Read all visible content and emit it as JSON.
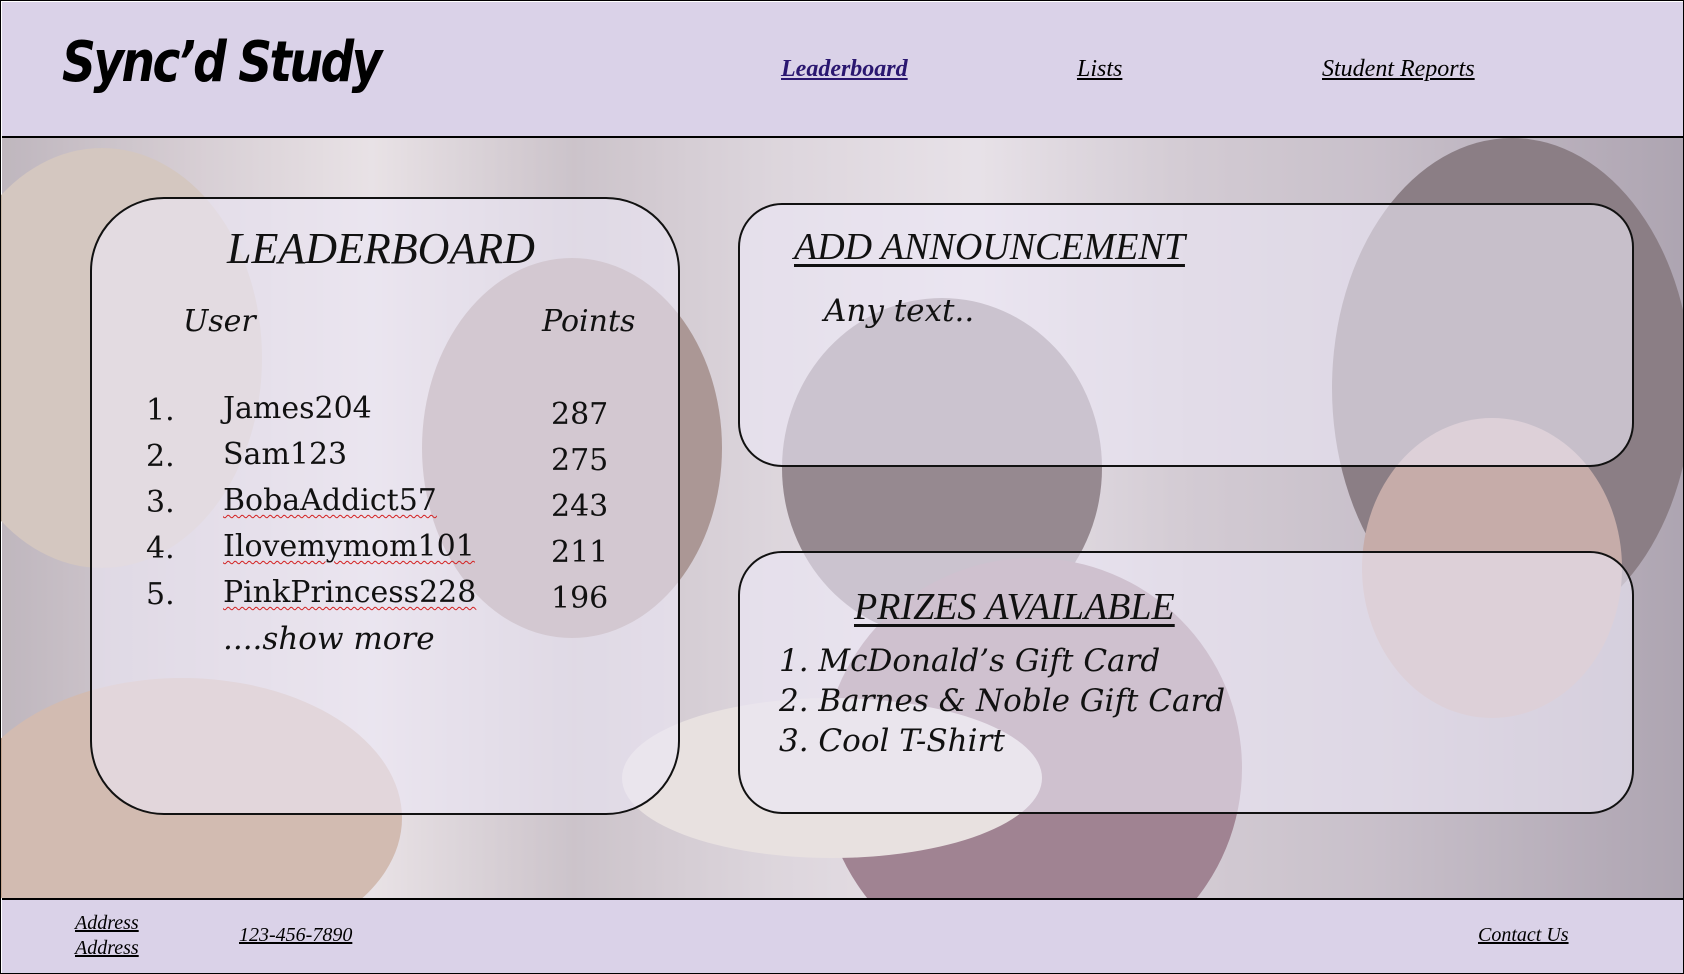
{
  "brand": {
    "logo": "Sync’d Study"
  },
  "nav": {
    "items": [
      {
        "label": "Leaderboard",
        "active": true
      },
      {
        "label": "Lists",
        "active": false
      },
      {
        "label": "Student Reports",
        "active": false
      }
    ]
  },
  "leaderboard": {
    "title": "LEADERBOARD",
    "col_user": "User",
    "col_points": "Points",
    "rows": [
      {
        "rank": "1.",
        "user": "James204",
        "points": "287"
      },
      {
        "rank": "2.",
        "user": "Sam123",
        "points": "275"
      },
      {
        "rank": "3.",
        "user": "BobaAddict57",
        "points": "243"
      },
      {
        "rank": "4.",
        "user": "Ilovemymom101",
        "points": "211"
      },
      {
        "rank": "5.",
        "user": "PinkPrincess228",
        "points": "196"
      }
    ],
    "show_more": "....show more"
  },
  "announcement": {
    "title": "ADD ANNOUNCEMENT",
    "text": "Any text.."
  },
  "prizes": {
    "title": "PRIZES AVAILABLE",
    "items": [
      "1. McDonald’s Gift Card",
      "2. Barnes & Noble Gift Card",
      "3. Cool T-Shirt"
    ]
  },
  "footer": {
    "address_line1": "Address",
    "address_line2": "Address",
    "phone": "123-456-7890",
    "contact": "Contact Us"
  },
  "colors": {
    "header_bg": "#dad2e8",
    "active_link": "#2a1770",
    "spellcheck": "#d31f1f"
  }
}
